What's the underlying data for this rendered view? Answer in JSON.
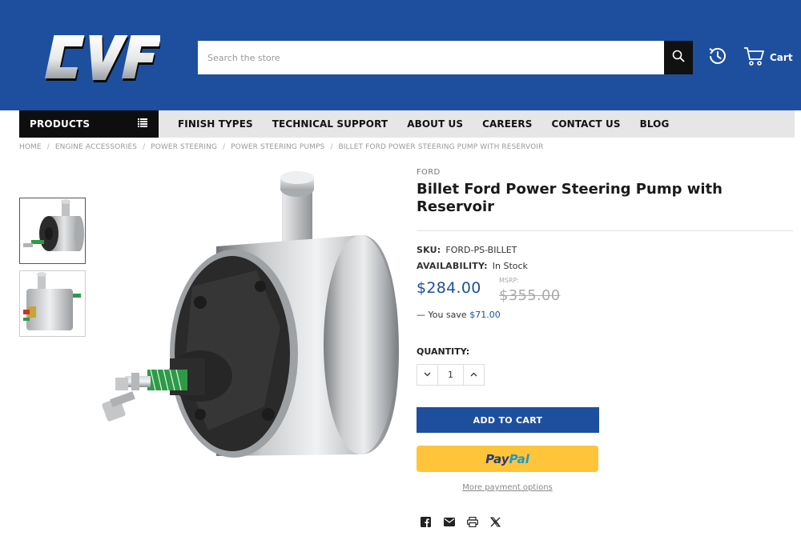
{
  "header": {
    "logo_text": "CVF",
    "search_placeholder": "Search the store",
    "cart_label": "Cart"
  },
  "nav": {
    "products_label": "PRODUCTS",
    "items": [
      "FINISH TYPES",
      "TECHNICAL SUPPORT",
      "ABOUT US",
      "CAREERS",
      "CONTACT US",
      "BLOG"
    ]
  },
  "breadcrumb": [
    "HOME",
    "ENGINE ACCESSORIES",
    "POWER STEERING",
    "POWER STEERING PUMPS",
    "BILLET FORD POWER STEERING PUMP WITH RESERVOIR"
  ],
  "product": {
    "brand": "FORD",
    "title": "Billet Ford Power Steering Pump with Reservoir",
    "sku_label": "SKU:",
    "sku": "FORD-PS-BILLET",
    "availability_label": "AVAILABILITY:",
    "availability": "In Stock",
    "price": "$284.00",
    "msrp_label": "MSRP:",
    "msrp": "$355.00",
    "save_prefix": "— You save",
    "save_amount": "$71.00",
    "quantity_label": "QUANTITY:",
    "quantity": "1",
    "add_to_cart": "ADD TO CART",
    "paypal_pay": "Pay",
    "paypal_pal": "Pal",
    "more_payment": "More payment options"
  },
  "colors": {
    "brand_blue": "#1d4f9e",
    "paypal_yellow": "#ffc439"
  },
  "icons": [
    "search-icon",
    "history-icon",
    "cart-icon",
    "grid-menu-icon",
    "chevron-down-icon",
    "chevron-up-icon",
    "facebook-icon",
    "email-icon",
    "print-icon",
    "x-icon"
  ]
}
